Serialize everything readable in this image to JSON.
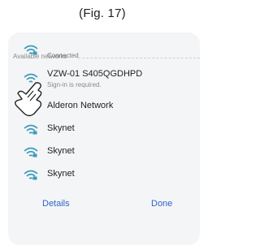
{
  "figure": {
    "caption": "(Fig. 17)"
  },
  "connected": {
    "status": "Connected"
  },
  "available": {
    "header": "Available networks",
    "networks": [
      {
        "ssid": "VZW-01 S405QGDHPD",
        "sub": "Sign-in is required.",
        "icon": "wifi-secured-icon"
      },
      {
        "ssid": "Alderon Network",
        "icon": "wifi-secured-icon"
      },
      {
        "ssid": "Skynet",
        "icon": "wifi-secured-icon"
      },
      {
        "ssid": "Skynet",
        "icon": "wifi-secured-icon"
      },
      {
        "ssid": "Skynet",
        "icon": "wifi-secured-icon"
      }
    ]
  },
  "actions": {
    "details": "Details",
    "done": "Done"
  },
  "colors": {
    "wifi_icon": "#3a9bb8",
    "action_text": "#2f64c8"
  }
}
